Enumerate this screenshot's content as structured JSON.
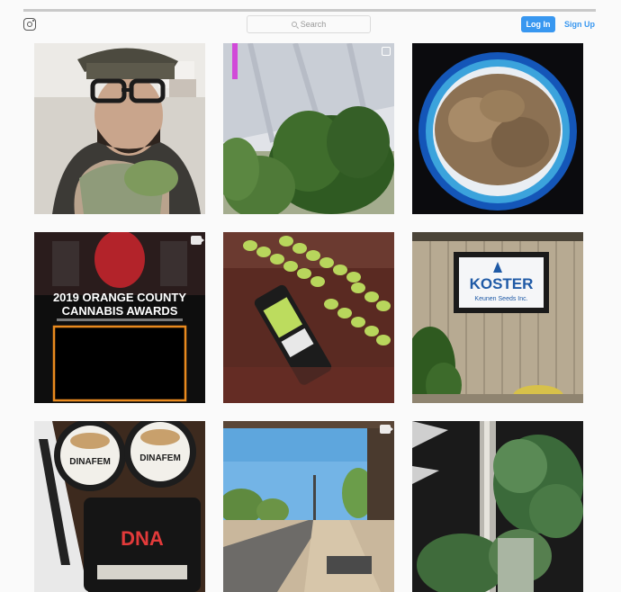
{
  "header": {
    "logo_icon": "instagram-camera-icon",
    "search_icon": "search-icon",
    "search_placeholder": "Search",
    "login_label": "Log In",
    "signup_label": "Sign Up",
    "accent_color": "#3897f0"
  },
  "posts": [
    {
      "name": "post-man-with-glasses-beanie",
      "media": "image"
    },
    {
      "name": "post-greenhouse-cannabis-plant",
      "media": "carousel"
    },
    {
      "name": "post-cannabis-bud-blue-container",
      "media": "image"
    },
    {
      "name": "post-orange-county-cannabis-awards",
      "media": "video",
      "text": {
        "line1": "2019 ORANGE COUNTY",
        "line2": "CANNABIS AWARDS"
      }
    },
    {
      "name": "post-cannabis-packages-rows",
      "media": "image"
    },
    {
      "name": "post-koster-sign-building",
      "media": "image",
      "text": {
        "sign_main": "KOSTER",
        "sign_sub": "Keunen Seeds Inc."
      }
    },
    {
      "name": "post-dinafem-dna-seed-tins",
      "media": "image",
      "text": {
        "tin_a": "DINAFEM",
        "tin_b": "DINAFEM",
        "box": "DNA"
      }
    },
    {
      "name": "post-desert-street-sidewalk",
      "media": "video"
    },
    {
      "name": "post-cannabis-plant-on-tray",
      "media": "image"
    }
  ]
}
